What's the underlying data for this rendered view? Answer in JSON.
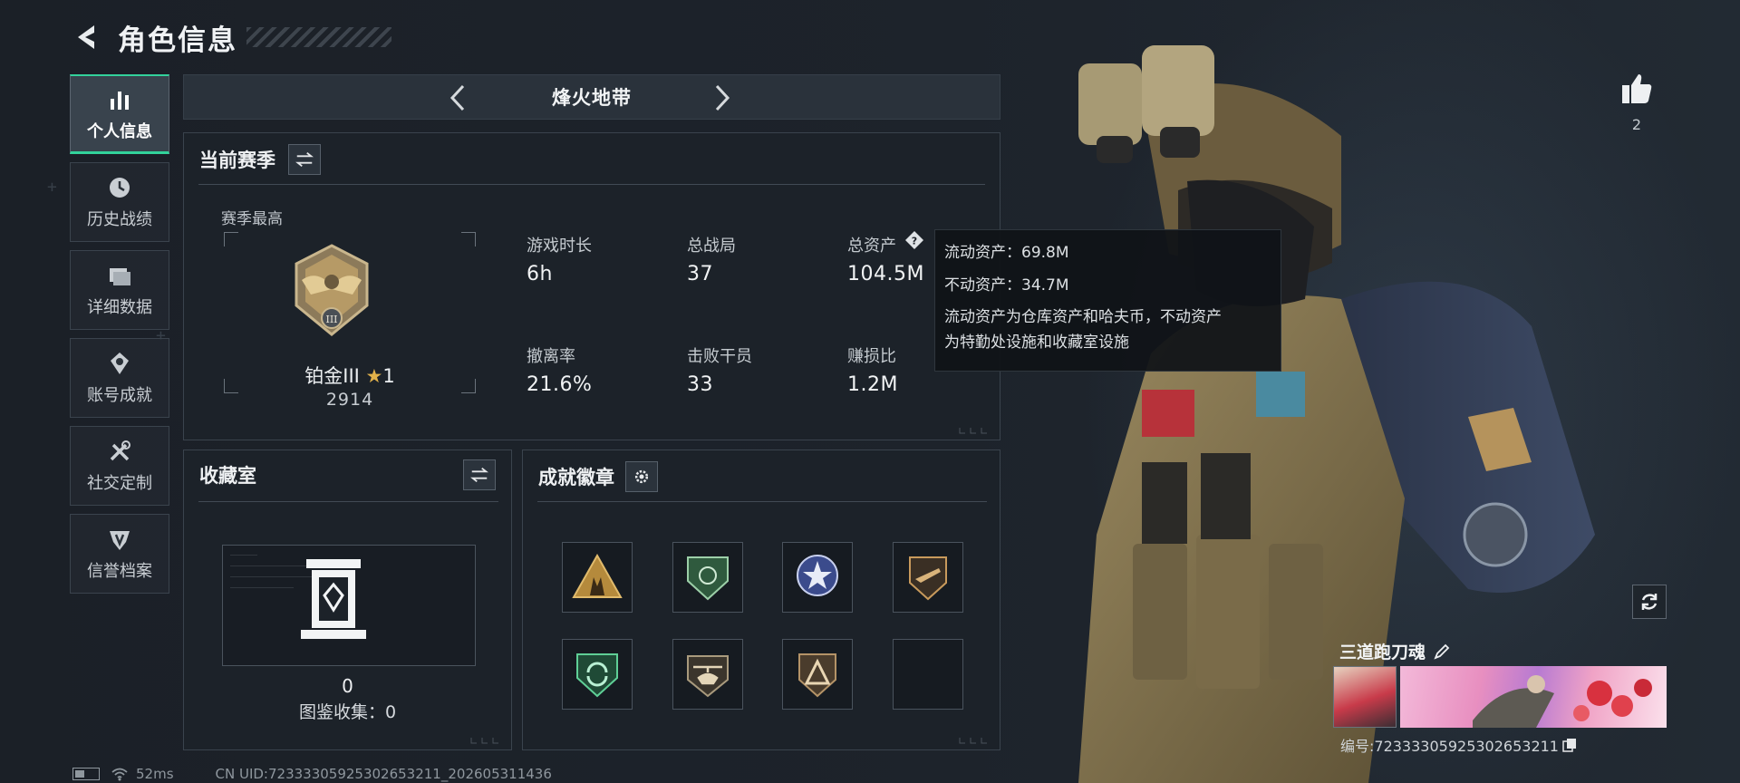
{
  "header": {
    "title": "角色信息",
    "back_icon": "back-arrow-icon"
  },
  "sidebar": {
    "items": [
      {
        "label": "个人信息",
        "icon": "bar-chart-icon",
        "active": true
      },
      {
        "label": "历史战绩",
        "icon": "clock-icon",
        "active": false
      },
      {
        "label": "详细数据",
        "icon": "folder-icon",
        "active": false
      },
      {
        "label": "账号成就",
        "icon": "medal-icon",
        "active": false
      },
      {
        "label": "社交定制",
        "icon": "tools-icon",
        "active": false
      },
      {
        "label": "信誉档案",
        "icon": "shield-icon",
        "active": false
      }
    ],
    "accent_color": "#32d29b"
  },
  "mode": {
    "title": "烽火地带"
  },
  "season": {
    "title": "当前赛季",
    "best_label": "赛季最高",
    "rank": {
      "name": "铂金III",
      "star": "★",
      "stars": "1",
      "score": "2914"
    },
    "stats": [
      {
        "label": "游戏时长",
        "value": "6h"
      },
      {
        "label": "总战局",
        "value": "37"
      },
      {
        "label": "总资产",
        "value": "104.5M"
      },
      {
        "label": "撤离率",
        "value": "21.6%"
      },
      {
        "label": "击败干员",
        "value": "33"
      },
      {
        "label": "赚损比",
        "value": "1.2M"
      }
    ]
  },
  "tooltip": {
    "liquid": "流动资产：69.8M",
    "fixed": "不动资产：34.7M",
    "desc_1": "流动资产为仓库资产和哈夫币，不动资产",
    "desc_2": "为特勤处设施和收藏室设施"
  },
  "collection": {
    "title": "收藏室",
    "count": "0",
    "sub": "图鉴收集：0"
  },
  "achievements": {
    "title": "成就徽章",
    "badges": [
      {
        "icon": "triangle-soldiers-badge-icon"
      },
      {
        "icon": "green-shield-badge-icon"
      },
      {
        "icon": "star-emblem-badge-icon"
      },
      {
        "icon": "rifle-shield-badge-icon"
      },
      {
        "icon": "green-recycle-badge-icon"
      },
      {
        "icon": "helicopter-badge-icon"
      },
      {
        "icon": "triangle-shield-badge-icon"
      },
      {
        "icon": "empty-slot"
      }
    ]
  },
  "player": {
    "likes": "2",
    "name": "三道跑刀魂",
    "id": "编号:7233330592530265321​1"
  },
  "footer": {
    "ping": "52ms",
    "uid": "CN UID:72333305925302653211_202605311436"
  }
}
